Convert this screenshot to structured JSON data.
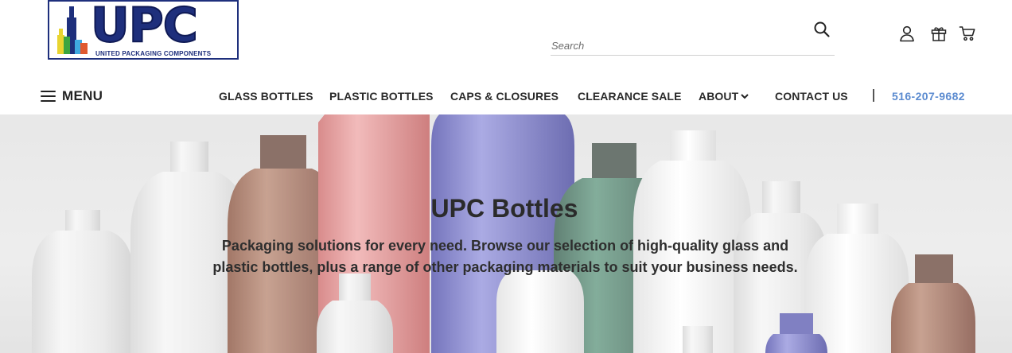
{
  "logo": {
    "letters": "UPC",
    "subtitle": "UNITED PACKAGING COMPONENTS"
  },
  "search": {
    "placeholder": "Search",
    "icon": "search-icon"
  },
  "header_icons": [
    {
      "name": "account-icon"
    },
    {
      "name": "gift-icon"
    },
    {
      "name": "cart-icon"
    }
  ],
  "nav": {
    "menu_label": "MENU",
    "items": [
      {
        "label": "GLASS BOTTLES"
      },
      {
        "label": "PLASTIC BOTTLES"
      },
      {
        "label": "CAPS & CLOSURES"
      },
      {
        "label": "CLEARANCE SALE"
      },
      {
        "label": "ABOUT"
      },
      {
        "label": "CONTACT US"
      }
    ],
    "phone": "516-207-9682"
  },
  "hero": {
    "title": "UPC Bottles",
    "text": "Packaging solutions for every need. Browse our selection of high-quality glass and plastic bottles, plus a range of other packaging materials to suit your business needs."
  },
  "colors": {
    "brand_navy": "#1e2f7c",
    "phone_blue": "#5b8bd0",
    "nav_text": "#2a2a2a"
  }
}
